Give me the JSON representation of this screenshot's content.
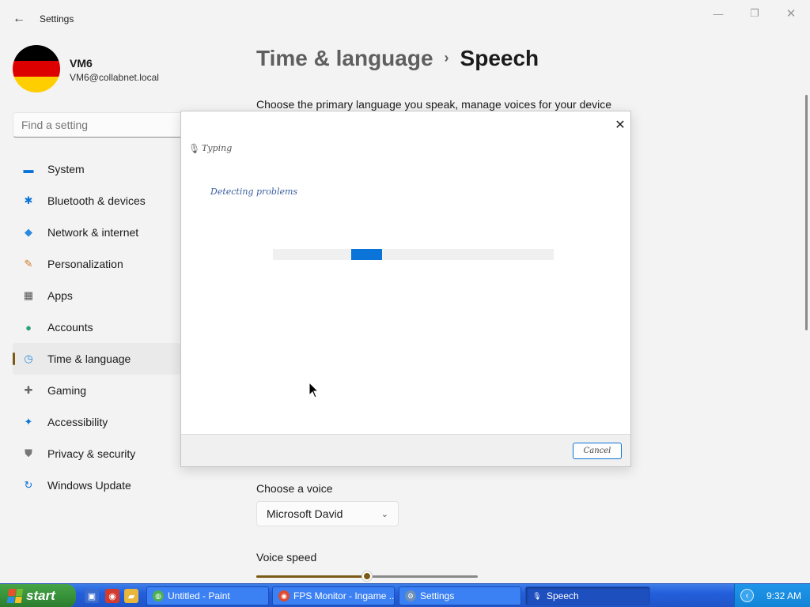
{
  "window": {
    "title": "Settings",
    "back_icon": "←",
    "minimize_icon": "—",
    "maximize_icon": "❐",
    "close_icon": "✕"
  },
  "profile": {
    "name": "VM6",
    "email": "VM6@collabnet.local",
    "avatar_colors": [
      "#000000",
      "#dd0000",
      "#ffce00"
    ]
  },
  "search": {
    "placeholder": "Find a setting"
  },
  "sidebar": {
    "items": [
      {
        "label": "System",
        "icon": "▬",
        "icon_color": "#0a74d8",
        "active": false
      },
      {
        "label": "Bluetooth & devices",
        "icon": "✱",
        "icon_color": "#0a74d8",
        "active": false
      },
      {
        "label": "Network & internet",
        "icon": "◆",
        "icon_color": "#2b8ae0",
        "active": false
      },
      {
        "label": "Personalization",
        "icon": "✎",
        "icon_color": "#d07a2c",
        "active": false
      },
      {
        "label": "Apps",
        "icon": "▦",
        "icon_color": "#555555",
        "active": false
      },
      {
        "label": "Accounts",
        "icon": "●",
        "icon_color": "#2ca37a",
        "active": false
      },
      {
        "label": "Time & language",
        "icon": "◷",
        "icon_color": "#2b8ae0",
        "active": true
      },
      {
        "label": "Gaming",
        "icon": "✚",
        "icon_color": "#666666",
        "active": false
      },
      {
        "label": "Accessibility",
        "icon": "✦",
        "icon_color": "#0a74d8",
        "active": false
      },
      {
        "label": "Privacy & security",
        "icon": "⛊",
        "icon_color": "#777777",
        "active": false
      },
      {
        "label": "Windows Update",
        "icon": "↻",
        "icon_color": "#0a74d8",
        "active": false
      }
    ]
  },
  "main": {
    "breadcrumb_parent": "Time & language",
    "breadcrumb_sep": "›",
    "breadcrumb_current": "Speech",
    "description": "Choose the primary language you speak, manage voices for your device",
    "voice_label": "Choose a voice",
    "voice_value": "Microsoft David",
    "voice_chevron": "⌄",
    "speed_label": "Voice speed",
    "speed_level": 0.5
  },
  "dialog": {
    "close_icon": "✕",
    "mic_icon": "🎙",
    "title": "Typing",
    "status": "Detecting problems",
    "progress_chunk_start": 0.28,
    "progress_chunk_width": 0.11,
    "cancel_label": "Cancel"
  },
  "taskbar": {
    "start_label": "start",
    "quick_launch": [
      {
        "icon": "▣",
        "color": "#3a6ccf"
      },
      {
        "icon": "◉",
        "color": "#d23b2e"
      },
      {
        "icon": "▰",
        "color": "#e8b63a"
      }
    ],
    "tasks": [
      {
        "label": "Untitled - Paint",
        "icon": "◍",
        "icon_bg": "#4caf50",
        "active": false
      },
      {
        "label": "FPS Monitor - Ingame ...",
        "icon": "◉",
        "icon_bg": "#e04a2f",
        "active": false
      },
      {
        "label": "Settings",
        "icon": "⚙",
        "icon_bg": "#6e8fb8",
        "active": false
      },
      {
        "label": "Speech",
        "icon": "🎙",
        "icon_bg": "transparent",
        "active": true
      }
    ],
    "tray_arrow": "‹",
    "clock": "9:32 AM"
  }
}
